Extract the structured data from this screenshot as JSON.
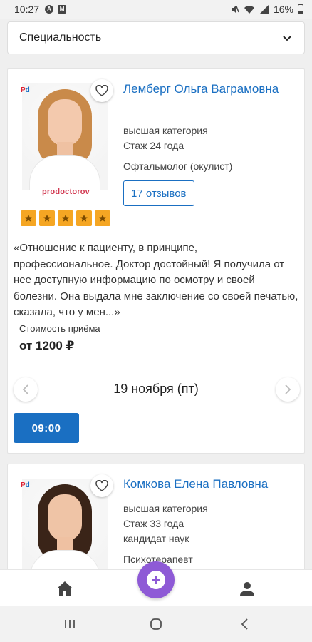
{
  "status_bar": {
    "time": "10:27",
    "battery": "16%"
  },
  "filter": {
    "specialty_label": "Специальность"
  },
  "doctors": [
    {
      "name": "Лемберг Ольга Ваграмовна",
      "category": "высшая категория",
      "experience": "Стаж 24 года",
      "specialty": "Офтальмолог (окулист)",
      "reviews_label": "17 отзывов",
      "rating_stars": 5,
      "brand": "prodoctorov",
      "quote": "«Отношение к пациенту, в принципе, профессиональное. Доктор достойный! Я получила от нее доступную информацию по осмотру и своей болезни. Она выдала мне заключение со своей печатью, сказала, что у мен...»",
      "price_label": "Стоимость приёма",
      "price": "от 1200 ₽",
      "date": "19 ноября (пт)",
      "slots": [
        "09:00"
      ]
    },
    {
      "name": "Комкова Елена Павловна",
      "category": "высшая категория",
      "experience": "Стаж 33 года",
      "degree": "кандидат наук",
      "specialty": "Психотерапевт"
    }
  ],
  "colors": {
    "accent": "#1a6fc2",
    "fab": "#8e5ad6",
    "star": "#f5a623"
  },
  "icons": {
    "home": "home-icon",
    "add": "add-icon",
    "profile": "profile-icon",
    "favorite": "heart-icon"
  }
}
